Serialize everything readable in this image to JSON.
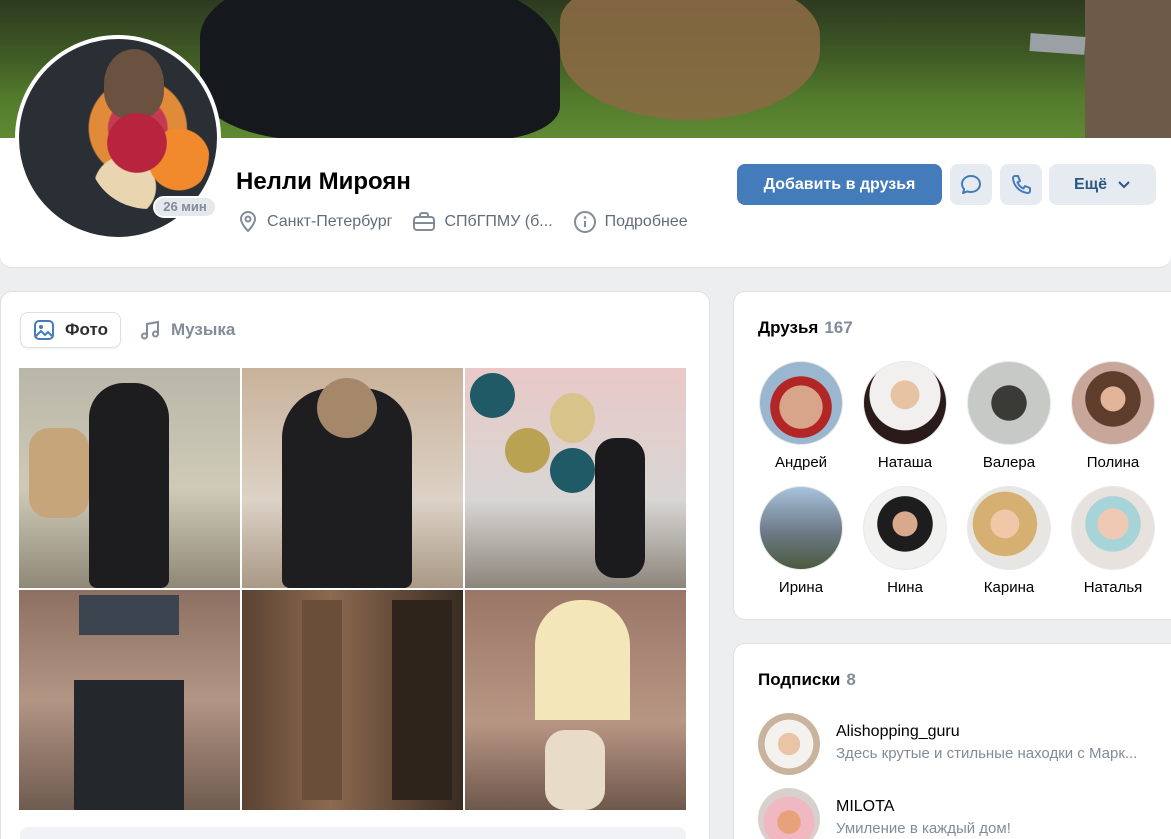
{
  "profile": {
    "name": "Нелли Мироян",
    "online_status": "26 мин",
    "city": "Санкт-Петербург",
    "education": "СПбГПМУ (б...",
    "details_link": "Подробнее",
    "add_friend_label": "Добавить в друзья",
    "more_label": "Ещё"
  },
  "tabs": {
    "photos": "Фото",
    "music": "Музыка"
  },
  "friends": {
    "title": "Друзья",
    "count": "167",
    "items": [
      {
        "name": "Андрей"
      },
      {
        "name": "Наташа"
      },
      {
        "name": "Валера"
      },
      {
        "name": "Полина"
      },
      {
        "name": "Ирина"
      },
      {
        "name": "Нина"
      },
      {
        "name": "Карина"
      },
      {
        "name": "Наталья"
      }
    ]
  },
  "subscriptions": {
    "title": "Подписки",
    "count": "8",
    "items": [
      {
        "name": "Alishopping_guru",
        "description": "Здесь крутые и стильные находки с Марк..."
      },
      {
        "name": "MILOTA",
        "description": "Умиление в каждый дом!"
      }
    ]
  },
  "colors": {
    "accent": "#447bba",
    "link": "#2a5885",
    "secondary_text": "#818c99",
    "background": "#edeef0"
  }
}
